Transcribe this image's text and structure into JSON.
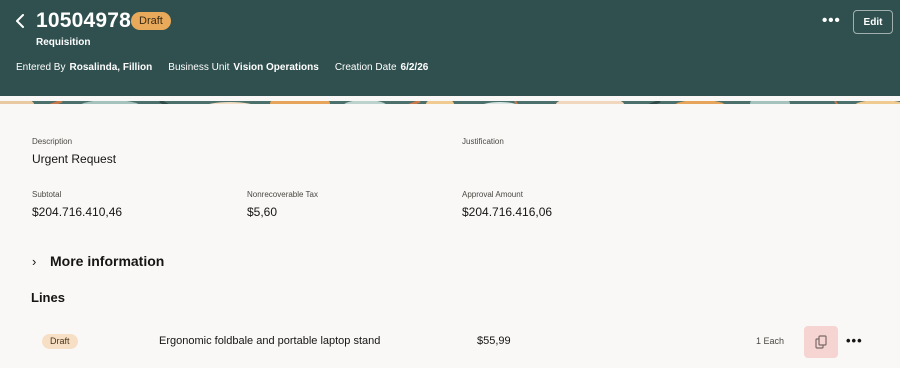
{
  "header": {
    "requisition_number": "10504978",
    "status_badge": "Draft",
    "document_type": "Requisition",
    "entered_by_label": "Entered By",
    "entered_by_value": "Rosalinda, Fillion",
    "business_unit_label": "Business Unit",
    "business_unit_value": "Vision Operations",
    "creation_date_label": "Creation Date",
    "creation_date_value": "6/2/26",
    "more_actions": "•••",
    "edit_label": "Edit"
  },
  "details": {
    "description_label": "Description",
    "description_value": "Urgent Request",
    "justification_label": "Justification",
    "justification_value": "",
    "subtotal_label": "Subtotal",
    "subtotal_value": "$204.716.410,46",
    "nonrecoverable_tax_label": "Nonrecoverable Tax",
    "nonrecoverable_tax_value": "$5,60",
    "approval_amount_label": "Approval Amount",
    "approval_amount_value": "$204.716.416,06"
  },
  "more_information": {
    "label": "More information",
    "chevron": "›"
  },
  "lines": {
    "title": "Lines",
    "items": [
      {
        "status": "Draft",
        "description": "Ergonomic foldbale and portable laptop stand",
        "price": "$55,99",
        "quantity": "1 Each",
        "more_actions": "•••"
      }
    ]
  },
  "colors": {
    "header_bg": "#30504f",
    "draft_badge_bg": "#e8a95b",
    "line_badge_bg": "#f6dfc4",
    "highlight_bg": "#f6d4d2",
    "page_bg": "#f9f8f6"
  },
  "icons": {
    "back": "chevron-left-icon",
    "line_action": "document-attachment-icon"
  }
}
